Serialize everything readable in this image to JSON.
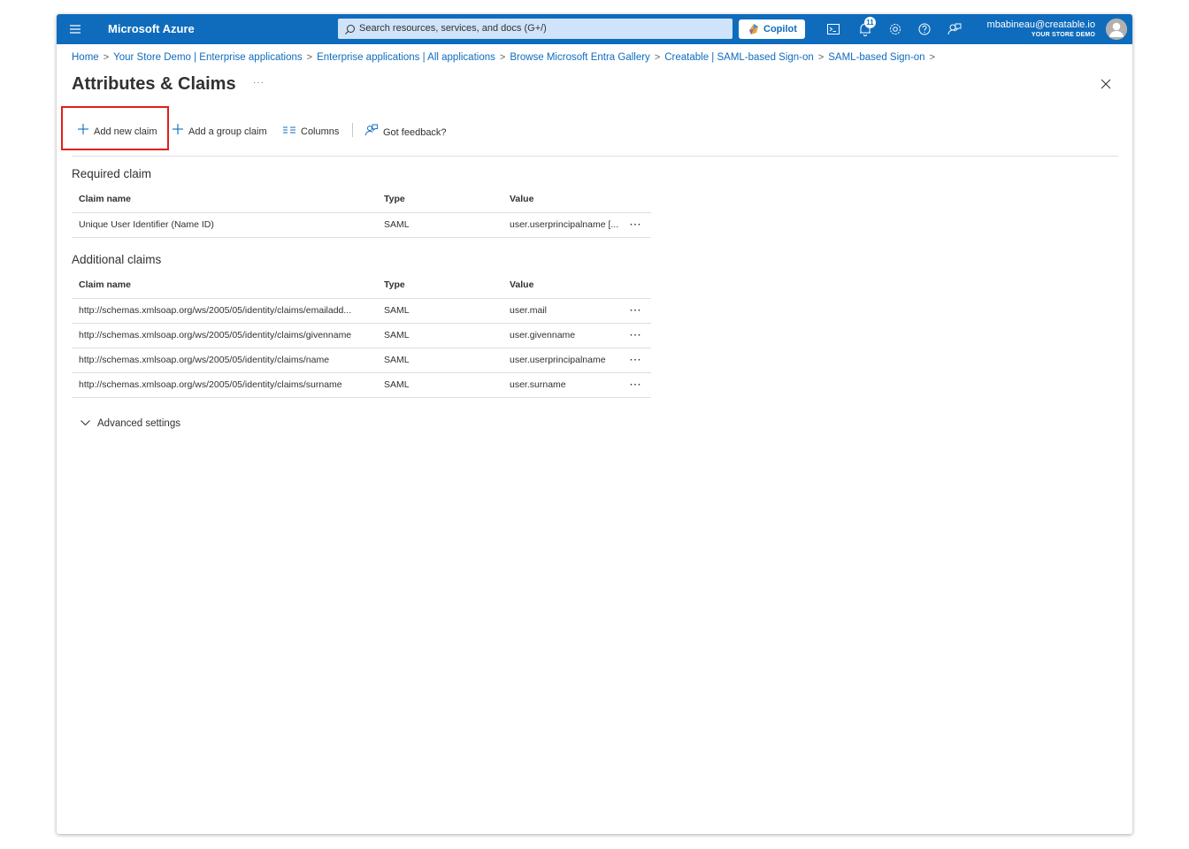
{
  "topbar": {
    "brand": "Microsoft Azure",
    "search_placeholder": "Search resources, services, and docs (G+/)",
    "copilot_label": "Copilot",
    "notification_count": "11",
    "user_email": "mbabineau@creatable.io",
    "user_tenant": "YOUR STORE DEMO",
    "icons": [
      "menu-icon",
      "search-icon",
      "copilot-icon",
      "cloud-shell-icon",
      "notifications-icon",
      "settings-icon",
      "help-icon",
      "feedback-icon"
    ],
    "accent_color": "#0f6cbd"
  },
  "breadcrumb": [
    "Home",
    "Your Store Demo | Enterprise applications",
    "Enterprise applications | All applications",
    "Browse Microsoft Entra Gallery",
    "Creatable | SAML-based Sign-on",
    "SAML-based Sign-on"
  ],
  "page": {
    "title": "Attributes & Claims",
    "more": "···"
  },
  "toolbar": {
    "add_new_claim": "Add new claim",
    "add_group_claim": "Add a group claim",
    "columns": "Columns",
    "feedback": "Got feedback?"
  },
  "required": {
    "title": "Required claim",
    "headers": {
      "name": "Claim name",
      "type": "Type",
      "value": "Value"
    },
    "rows": [
      {
        "name": "Unique User Identifier (Name ID)",
        "type": "SAML",
        "value": "user.userprincipalname [..."
      }
    ]
  },
  "additional": {
    "title": "Additional claims",
    "headers": {
      "name": "Claim name",
      "type": "Type",
      "value": "Value"
    },
    "rows": [
      {
        "name": "http://schemas.xmlsoap.org/ws/2005/05/identity/claims/emailadd...",
        "type": "SAML",
        "value": "user.mail"
      },
      {
        "name": "http://schemas.xmlsoap.org/ws/2005/05/identity/claims/givenname",
        "type": "SAML",
        "value": "user.givenname"
      },
      {
        "name": "http://schemas.xmlsoap.org/ws/2005/05/identity/claims/name",
        "type": "SAML",
        "value": "user.userprincipalname"
      },
      {
        "name": "http://schemas.xmlsoap.org/ws/2005/05/identity/claims/surname",
        "type": "SAML",
        "value": "user.surname"
      }
    ]
  },
  "row_more": "···",
  "advanced_settings": "Advanced settings",
  "highlight_color": "#e0201a"
}
